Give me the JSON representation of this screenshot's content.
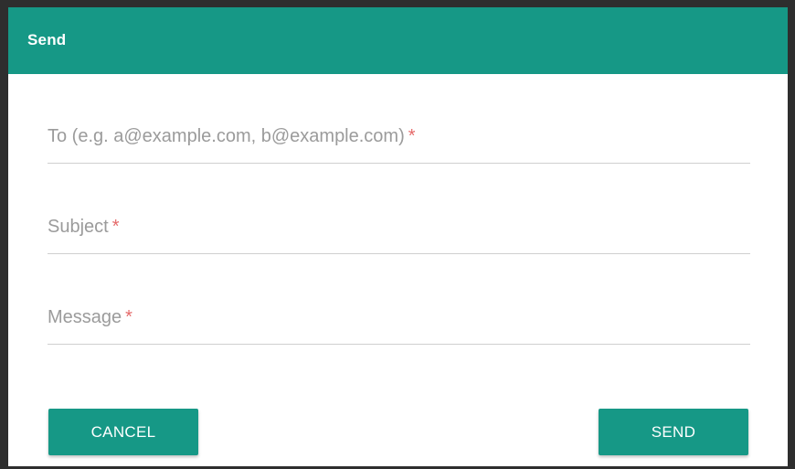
{
  "dialog": {
    "title": "Send",
    "colors": {
      "accent": "#169886",
      "required": "#e56a6a",
      "placeholder": "#9b9b9b"
    }
  },
  "form": {
    "to": {
      "label": "To (e.g. a@example.com, b@example.com)",
      "required_mark": "*",
      "value": ""
    },
    "subject": {
      "label": "Subject",
      "required_mark": "*",
      "value": ""
    },
    "message": {
      "label": "Message",
      "required_mark": "*",
      "value": ""
    }
  },
  "actions": {
    "cancel_label": "CANCEL",
    "send_label": "SEND"
  }
}
